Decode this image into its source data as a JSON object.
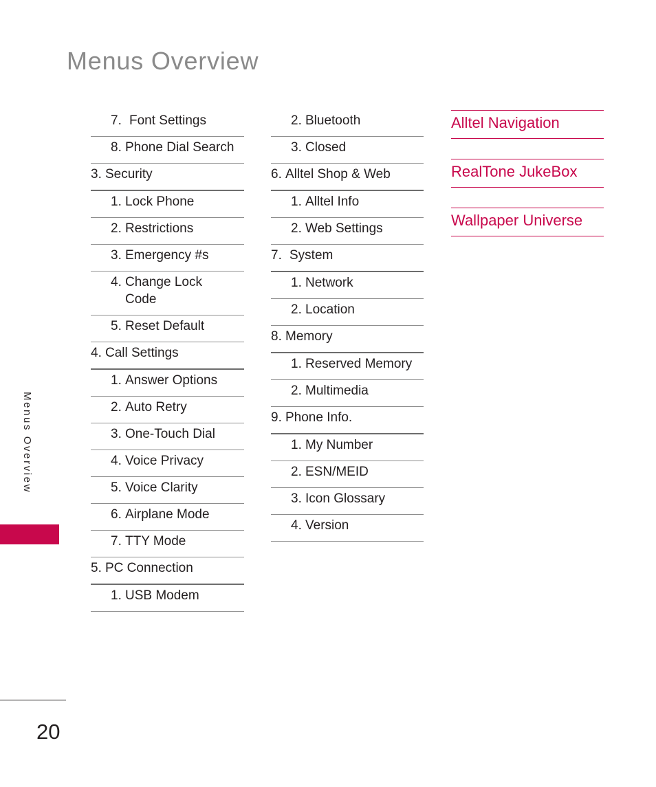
{
  "page": {
    "title": "Menus Overview",
    "running_head": "Menus Overview",
    "folio": "20"
  },
  "columns": [
    {
      "name": "column-one",
      "items": [
        {
          "num": "7.",
          "label": "Font Settings",
          "level": "sub",
          "wide": true,
          "wrap": false
        },
        {
          "num": "8.",
          "label": "Phone Dial Search",
          "level": "sub",
          "wide": false,
          "wrap": true
        },
        {
          "num": "3.",
          "label": "Security",
          "level": "top",
          "wide": false,
          "wrap": false
        },
        {
          "num": "1.",
          "label": "Lock Phone",
          "level": "sub",
          "wide": false,
          "wrap": false
        },
        {
          "num": "2.",
          "label": "Restrictions",
          "level": "sub",
          "wide": false,
          "wrap": false
        },
        {
          "num": "3.",
          "label": "Emergency #s",
          "level": "sub",
          "wide": false,
          "wrap": false
        },
        {
          "num": "4.",
          "label": "Change Lock Code",
          "level": "sub",
          "wide": false,
          "wrap": true
        },
        {
          "num": "5.",
          "label": "Reset Default",
          "level": "sub",
          "wide": false,
          "wrap": false
        },
        {
          "num": "4.",
          "label": "Call Settings",
          "level": "top",
          "wide": false,
          "wrap": false
        },
        {
          "num": "1.",
          "label": "Answer Options",
          "level": "sub",
          "wide": false,
          "wrap": false
        },
        {
          "num": "2.",
          "label": "Auto Retry",
          "level": "sub",
          "wide": false,
          "wrap": false
        },
        {
          "num": "3.",
          "label": "One-Touch Dial",
          "level": "sub",
          "wide": false,
          "wrap": false
        },
        {
          "num": "4.",
          "label": "Voice Privacy",
          "level": "sub",
          "wide": false,
          "wrap": false
        },
        {
          "num": "5.",
          "label": "Voice Clarity",
          "level": "sub",
          "wide": false,
          "wrap": false
        },
        {
          "num": "6.",
          "label": "Airplane Mode",
          "level": "sub",
          "wide": false,
          "wrap": false
        },
        {
          "num": "7.",
          "label": "TTY Mode",
          "level": "sub",
          "wide": false,
          "wrap": false
        },
        {
          "num": "5.",
          "label": "PC Connection",
          "level": "top",
          "wide": false,
          "wrap": false
        },
        {
          "num": "1.",
          "label": "USB Modem",
          "level": "sub",
          "wide": false,
          "wrap": false
        }
      ]
    },
    {
      "name": "column-two",
      "items": [
        {
          "num": "2.",
          "label": "Bluetooth",
          "level": "sub",
          "wide": false,
          "wrap": false
        },
        {
          "num": "3.",
          "label": "Closed",
          "level": "sub",
          "wide": false,
          "wrap": false
        },
        {
          "num": "6.",
          "label": "Alltel Shop & Web",
          "level": "top",
          "wide": false,
          "wrap": false
        },
        {
          "num": "1.",
          "label": "Alltel Info",
          "level": "sub",
          "wide": false,
          "wrap": false
        },
        {
          "num": "2.",
          "label": "Web Settings",
          "level": "sub",
          "wide": false,
          "wrap": false
        },
        {
          "num": "7.",
          "label": "System",
          "level": "top",
          "wide": true,
          "wrap": false
        },
        {
          "num": "1.",
          "label": "Network",
          "level": "sub",
          "wide": false,
          "wrap": false
        },
        {
          "num": "2.",
          "label": "Location",
          "level": "sub",
          "wide": false,
          "wrap": false
        },
        {
          "num": "8.",
          "label": "Memory",
          "level": "top",
          "wide": false,
          "wrap": false
        },
        {
          "num": "1.",
          "label": "Reserved Memory",
          "level": "sub",
          "wide": false,
          "wrap": true
        },
        {
          "num": "2.",
          "label": "Multimedia",
          "level": "sub",
          "wide": false,
          "wrap": false
        },
        {
          "num": "9.",
          "label": "Phone Info.",
          "level": "top",
          "wide": false,
          "wrap": false
        },
        {
          "num": "1.",
          "label": "My Number",
          "level": "sub",
          "wide": false,
          "wrap": false
        },
        {
          "num": "2.",
          "label": "ESN/MEID",
          "level": "sub",
          "wide": false,
          "wrap": false
        },
        {
          "num": "3.",
          "label": "Icon Glossary",
          "level": "sub",
          "wide": false,
          "wrap": false
        },
        {
          "num": "4.",
          "label": "Version",
          "level": "sub",
          "wide": false,
          "wrap": false
        }
      ]
    }
  ],
  "highlighted": {
    "name": "column-three",
    "items": [
      {
        "label": "Alltel Navigation"
      },
      {
        "label": "RealTone JukeBox"
      },
      {
        "label": "Wallpaper Universe"
      }
    ]
  },
  "colors": {
    "accent": "#c8084c",
    "title_gray": "#8a8a8a",
    "body_text": "#231f20",
    "rule": "#8e8e8e",
    "rule_strong": "#6d6d6d"
  }
}
